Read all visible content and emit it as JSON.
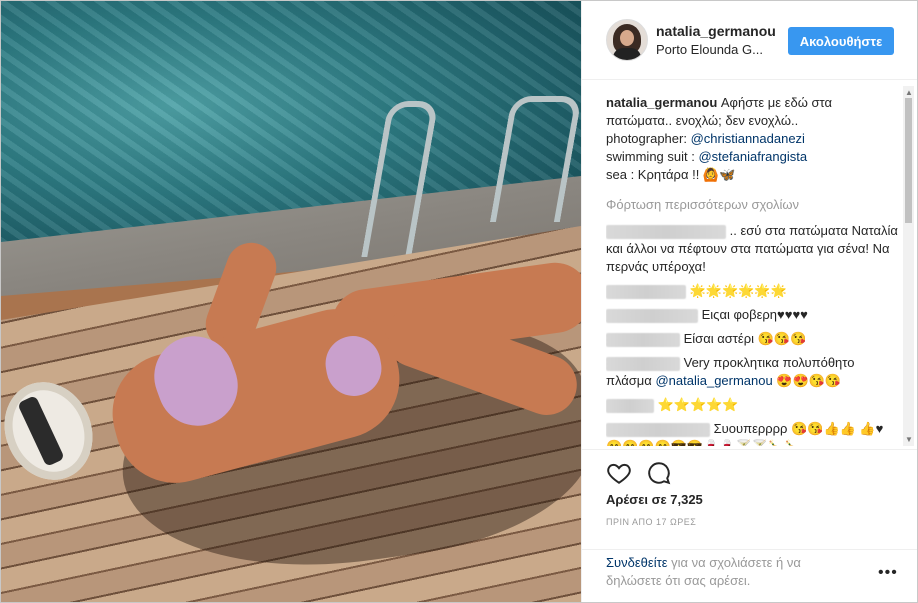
{
  "post": {
    "username": "natalia_germanou",
    "location": "Porto Elounda G...",
    "follow_label": "Ακολουθήστε"
  },
  "caption": {
    "username": "natalia_germanou",
    "text1": "Αφήστε με εδώ στα πατώματα.. ενοχλώ; δεν ενοχλώ..",
    "photographer_label": "photographer:",
    "photographer": "@christiannadanezi",
    "suit_label": "swimming suit :",
    "suit": "@stefaniafrangista",
    "sea": "sea : Κρητάρα !! 🙆🦋"
  },
  "load_more": "Φόρτωση περισσότερων σχολίων",
  "comments": [
    {
      "text": ".. εσύ στα πατώματα Ναταλία και άλλοι να πέφτουν στα πατώματα για σένα! Να περνάς υπέροχα!"
    },
    {
      "text": "🌟🌟🌟🌟🌟🌟"
    },
    {
      "text": "Ειςαι φοβερη♥♥♥♥"
    },
    {
      "text": "Είσαι αστέρι 😘😘😘"
    },
    {
      "text": "Very προκλητικα πολυπόθητο πλάσμα",
      "mention": "@natalia_germanou",
      "suffix": "😍😍😘😘"
    },
    {
      "text": "⭐⭐⭐⭐⭐"
    },
    {
      "text": "Συουπερρρρ 😘😘👍👍 👍♥😊😊😊😊😎😎🍷🍷🍸🍸🍾🍾"
    }
  ],
  "actions": {
    "likes": "Αρέσει σε 7,325",
    "time": "ΠΡΙΝ ΑΠΟ 17 ΩΡΕΣ",
    "login_link": "Συνδεθείτε",
    "login_text": " για να σχολιάσετε ή να δηλώσετε ότι σας αρέσει.",
    "more": "•••"
  }
}
